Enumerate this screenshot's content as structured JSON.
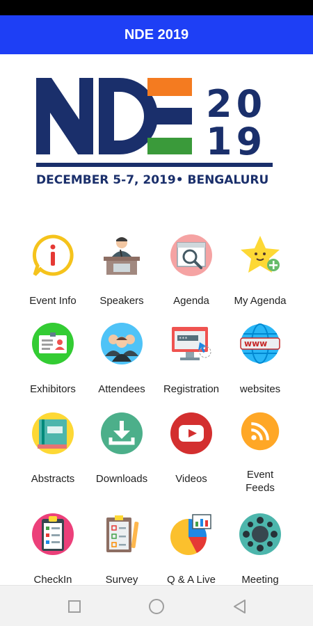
{
  "app_bar": {
    "title": "NDE 2019"
  },
  "logo": {
    "letters": "NDE",
    "year_top": "20",
    "year_bottom": "19",
    "tagline": "DECEMBER 5-7, 2019• BENGALURU",
    "colors": {
      "navy": "#1a2f6b",
      "saffron": "#f47b20",
      "green": "#3a9a3a"
    }
  },
  "menu": {
    "items": [
      {
        "label": "Event Info",
        "icon": "info-icon"
      },
      {
        "label": "Speakers",
        "icon": "speaker-podium-icon"
      },
      {
        "label": "Agenda",
        "icon": "agenda-search-icon"
      },
      {
        "label": "My Agenda",
        "icon": "star-add-icon"
      },
      {
        "label": "Exhibitors",
        "icon": "exhibitor-id-card-icon"
      },
      {
        "label": "Attendees",
        "icon": "attendees-group-icon"
      },
      {
        "label": "Registration",
        "icon": "registration-monitor-icon"
      },
      {
        "label": "websites",
        "icon": "www-globe-icon"
      },
      {
        "label": "Abstracts",
        "icon": "abstract-book-icon"
      },
      {
        "label": "Downloads",
        "icon": "download-icon"
      },
      {
        "label": "Videos",
        "icon": "video-play-icon"
      },
      {
        "label": "Event\nFeeds",
        "icon": "rss-feed-icon"
      },
      {
        "label": "CheckIn",
        "icon": "checkin-clipboard-icon"
      },
      {
        "label": "Survey",
        "icon": "survey-checklist-icon"
      },
      {
        "label": "Q & A Live",
        "icon": "qa-chart-icon"
      },
      {
        "label": "Meeting",
        "icon": "meeting-table-icon"
      }
    ]
  },
  "nav_bar": {
    "buttons": [
      "recents-square-icon",
      "home-circle-icon",
      "back-triangle-icon"
    ]
  },
  "colors": {
    "app_bar": "#1e3ff5",
    "status_bar": "#000000",
    "nav_bar": "#f2f2f2"
  }
}
